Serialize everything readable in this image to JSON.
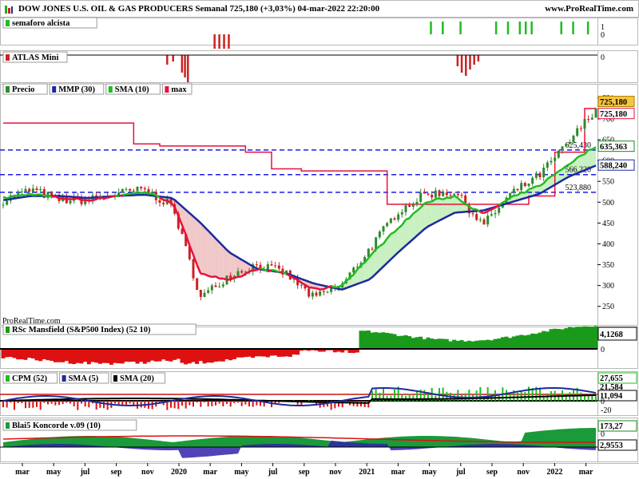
{
  "header": {
    "title": "DOW JONES U.S. OIL & GAS PRODUCERS Semanal 725,180 (+3,03%) 04-mar-2022 22:20:00",
    "site": "www.ProRealTime.com"
  },
  "watermark": "ProRealTime.com",
  "colors": {
    "price_up": "#2e8b2e",
    "price_down": "#cc2222",
    "mmp": "#1c2a9c",
    "sma_green": "#22bb22",
    "sma_red": "#e8103c",
    "max_line": "#e8103c",
    "dashed": "#1a1aee",
    "bull_fill": "#c8f0c0",
    "bear_fill": "#f0c8c8"
  },
  "panels": {
    "semaforo": {
      "label": "semaforo alcista",
      "ticks": [
        "1",
        "0"
      ]
    },
    "atlas": {
      "label": "ATLAS Mini",
      "ticks": [
        "0"
      ]
    },
    "price": {
      "legend": {
        "precio": "Precio",
        "mmp": "MMP (30)",
        "sma": "SMA (10)",
        "max": "max"
      },
      "ticks": [
        "750",
        "700",
        "650",
        "600",
        "550",
        "500",
        "450",
        "400",
        "350",
        "300",
        "250"
      ],
      "boxes": {
        "last": "725,180",
        "max": "725,180",
        "sma": "635,363",
        "mmp": "588,240"
      },
      "level_labels": [
        "625,430",
        "566,220",
        "523,880"
      ]
    },
    "rsc": {
      "label": "RSc Mansfield (S&P500 Index) (52 10)",
      "box": "4,1268",
      "ticks": [
        "0"
      ]
    },
    "cpm": {
      "legend": {
        "cpm": "CPM (52)",
        "sma5": "SMA (5)",
        "sma20": "SMA (20)"
      },
      "boxes": [
        "27,655",
        "21,584",
        "11,094"
      ],
      "ticks": [
        "0",
        "-20"
      ]
    },
    "koncorde": {
      "label": "Blai5 Koncorde v.09 (10)",
      "boxes": [
        "173,27",
        "2,9553"
      ],
      "ticks": [
        "0"
      ]
    }
  },
  "xaxis": [
    "mar",
    "may",
    "jul",
    "sep",
    "nov",
    "2020",
    "mar",
    "may",
    "jul",
    "sep",
    "nov",
    "2021",
    "mar",
    "may",
    "jul",
    "sep",
    "nov",
    "2022",
    "mar"
  ],
  "chart_data": {
    "type": "line",
    "title": "DOW JONES U.S. OIL & GAS PRODUCERS Semanal",
    "x": [
      "2019-02",
      "2019-04",
      "2019-06",
      "2019-08",
      "2019-10",
      "2019-12",
      "2020-02",
      "2020-03",
      "2020-04",
      "2020-06",
      "2020-08",
      "2020-10",
      "2020-11",
      "2021-01",
      "2021-03",
      "2021-05",
      "2021-07",
      "2021-09",
      "2021-11",
      "2022-01",
      "2022-02",
      "2022-03"
    ],
    "series": [
      {
        "name": "Precio",
        "values": [
          505,
          530,
          505,
          505,
          520,
          530,
          490,
          270,
          325,
          350,
          330,
          270,
          300,
          390,
          480,
          520,
          525,
          445,
          520,
          565,
          640,
          725
        ]
      },
      {
        "name": "MMP (30)",
        "values": [
          505,
          515,
          515,
          510,
          515,
          518,
          510,
          450,
          380,
          340,
          330,
          305,
          290,
          315,
          380,
          440,
          475,
          480,
          500,
          520,
          560,
          588
        ]
      },
      {
        "name": "SMA (10)",
        "values": [
          510,
          520,
          510,
          505,
          515,
          525,
          500,
          330,
          310,
          340,
          330,
          290,
          300,
          370,
          440,
          500,
          515,
          470,
          510,
          540,
          590,
          635
        ]
      },
      {
        "name": "max",
        "values": [
          690,
          690,
          690,
          690,
          690,
          640,
          635,
          635,
          635,
          620,
          580,
          575,
          575,
          575,
          495,
          495,
          495,
          495,
          495,
          515,
          620,
          725
        ]
      }
    ],
    "levels": [
      625.43,
      566.22,
      523.88
    ],
    "ylim": [
      215,
      765
    ],
    "xlabel": "",
    "ylabel": ""
  }
}
